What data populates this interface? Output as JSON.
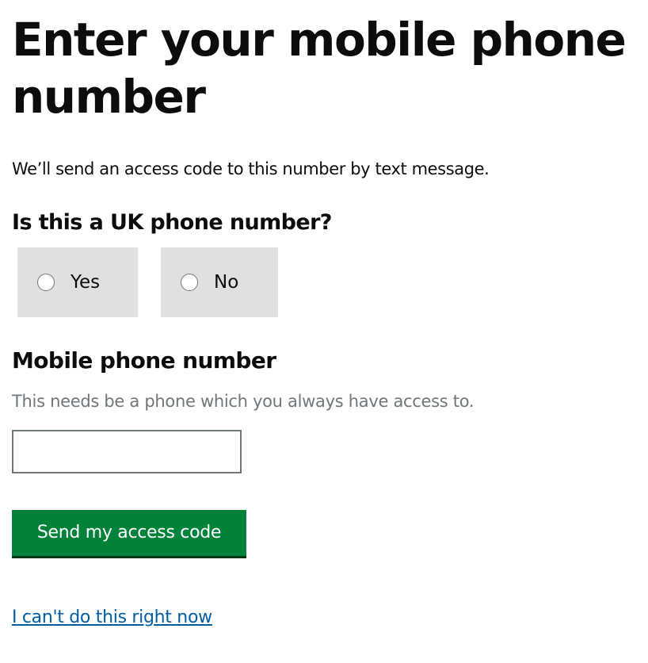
{
  "page": {
    "title": "Enter your mobile phone number",
    "intro": "We’ll send an access code to this number by text message."
  },
  "uk_question": {
    "legend": "Is this a UK phone number?",
    "options": [
      {
        "label": "Yes",
        "selected": false
      },
      {
        "label": "No",
        "selected": false
      }
    ]
  },
  "phone_field": {
    "label": "Mobile phone number",
    "hint": "This needs be a phone which you always have access to.",
    "value": ""
  },
  "actions": {
    "submit_label": "Send my access code",
    "skip_link": "I can't do this right now"
  },
  "colors": {
    "submit_button": "#00823b",
    "link": "#005ea5",
    "radio_background": "#dee0e2",
    "hint_text": "#6f777b"
  }
}
